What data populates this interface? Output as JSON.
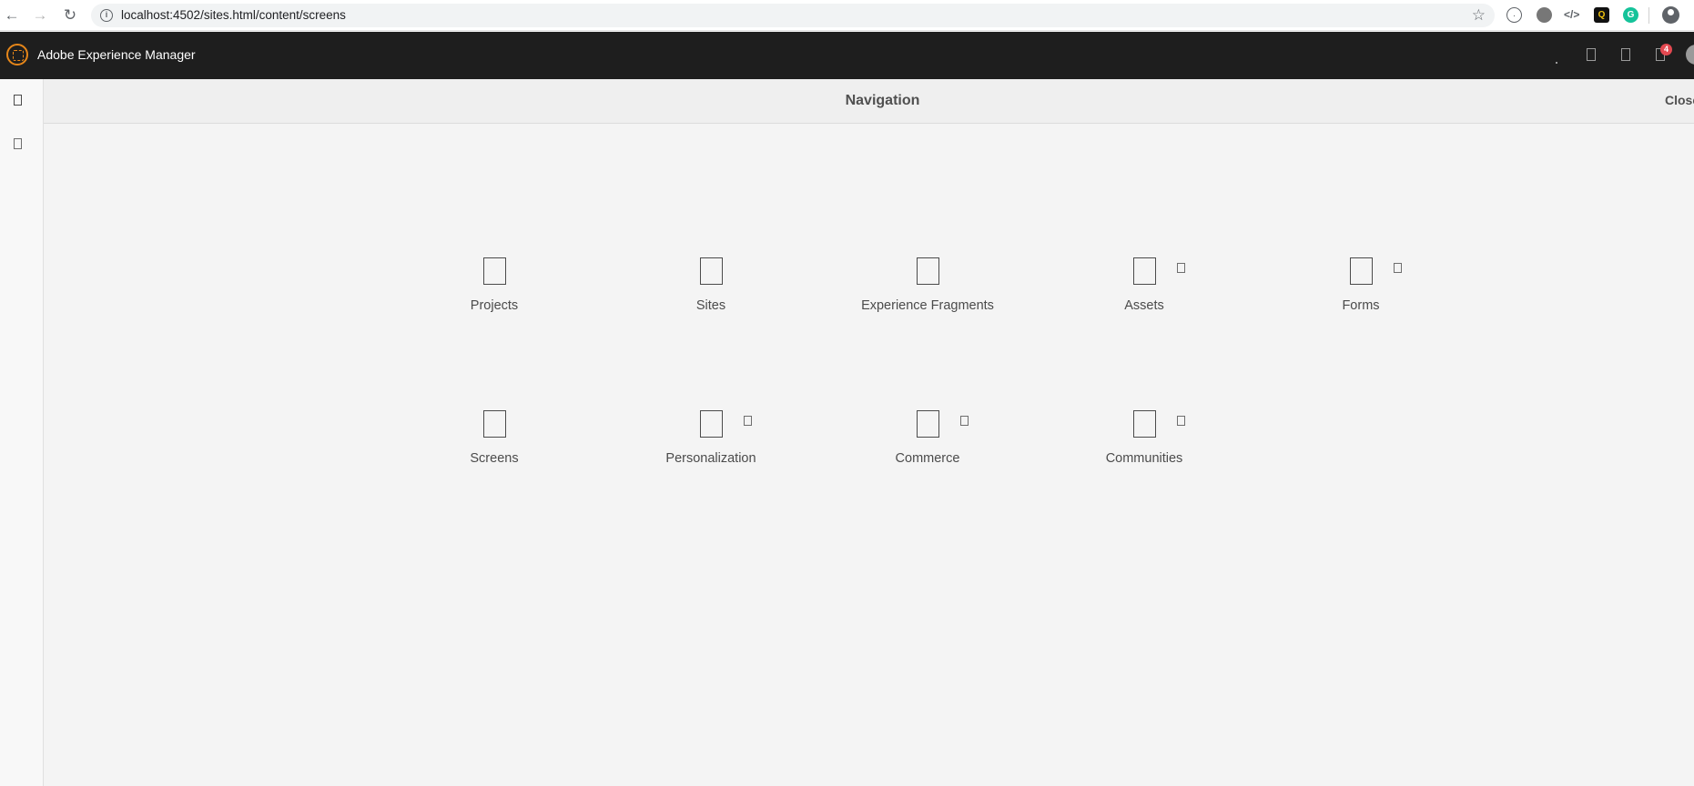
{
  "browser": {
    "url": "localhost:4502/sites.html/content/screens"
  },
  "header": {
    "brand": "Adobe Experience Manager",
    "notification_count": "4"
  },
  "navigation": {
    "title": "Navigation",
    "close_label": "Close"
  },
  "tiles": [
    {
      "label": "Projects"
    },
    {
      "label": "Sites"
    },
    {
      "label": "Experience Fragments"
    },
    {
      "label": "Assets"
    },
    {
      "label": "Forms"
    },
    {
      "label": "Screens"
    },
    {
      "label": "Personalization"
    },
    {
      "label": "Commerce"
    },
    {
      "label": "Communities"
    }
  ],
  "colors": {
    "shell": "#1e1e1e",
    "accent": "#e68619",
    "badge": "#e34850",
    "panel": "#f4f4f4"
  }
}
